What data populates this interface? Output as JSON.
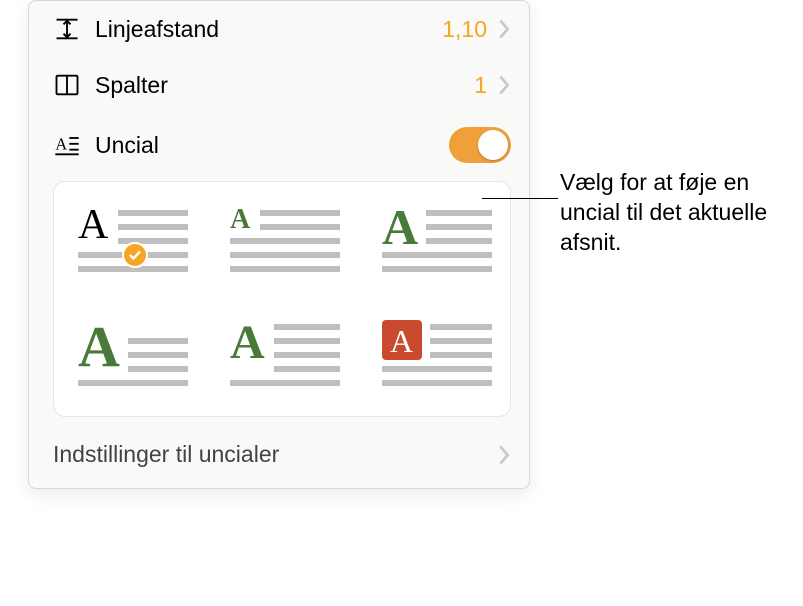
{
  "rows": {
    "line_spacing": {
      "label": "Linjeafstand",
      "value": "1,10"
    },
    "columns": {
      "label": "Spalter",
      "value": "1"
    },
    "uncial": {
      "label": "Uncial"
    }
  },
  "settings_label": "Indstillinger til uncialer",
  "callout_text": "Vælg for at føje en uncial til det aktuelle afsnit.",
  "colors": {
    "accent": "#f5a623",
    "dropcap_green": "#4a7a3a",
    "dropcap_red": "#c94a2f"
  }
}
